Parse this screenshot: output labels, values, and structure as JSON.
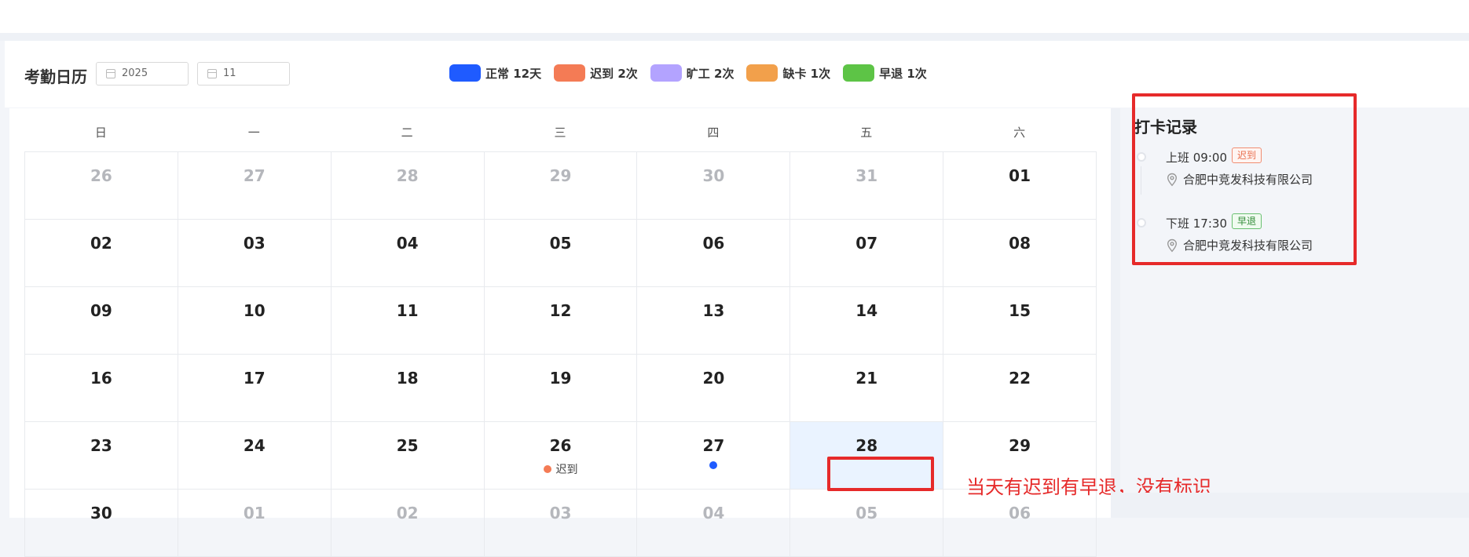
{
  "header": {
    "title": "考勤日历",
    "year_value": "2025",
    "month_value": "11"
  },
  "legend": [
    {
      "label": "正常 12天",
      "color": "#1f5bff"
    },
    {
      "label": "迟到 2次",
      "color": "#f47b55"
    },
    {
      "label": "旷工 2次",
      "color": "#b3a3ff"
    },
    {
      "label": "缺卡 1次",
      "color": "#f2a04b"
    },
    {
      "label": "早退 1次",
      "color": "#5dc446"
    }
  ],
  "calendar": {
    "weekdays": [
      "日",
      "一",
      "二",
      "三",
      "四",
      "五",
      "六"
    ],
    "days": [
      {
        "num": "26",
        "other": true
      },
      {
        "num": "27",
        "other": true
      },
      {
        "num": "28",
        "other": true
      },
      {
        "num": "29",
        "other": true
      },
      {
        "num": "30",
        "other": true
      },
      {
        "num": "31",
        "other": true
      },
      {
        "num": "01"
      },
      {
        "num": "02"
      },
      {
        "num": "03"
      },
      {
        "num": "04"
      },
      {
        "num": "05"
      },
      {
        "num": "06"
      },
      {
        "num": "07"
      },
      {
        "num": "08"
      },
      {
        "num": "09"
      },
      {
        "num": "10"
      },
      {
        "num": "11"
      },
      {
        "num": "12"
      },
      {
        "num": "13"
      },
      {
        "num": "14"
      },
      {
        "num": "15"
      },
      {
        "num": "16"
      },
      {
        "num": "17"
      },
      {
        "num": "18"
      },
      {
        "num": "19"
      },
      {
        "num": "20"
      },
      {
        "num": "21"
      },
      {
        "num": "22"
      },
      {
        "num": "23"
      },
      {
        "num": "24"
      },
      {
        "num": "25"
      },
      {
        "num": "26",
        "mark": {
          "color": "#f47b55",
          "label": "迟到"
        }
      },
      {
        "num": "27",
        "mark": {
          "color": "#1f5bff",
          "label": ""
        }
      },
      {
        "num": "28",
        "selected": true
      },
      {
        "num": "29"
      },
      {
        "num": "30"
      },
      {
        "num": "01",
        "other": true
      },
      {
        "num": "02",
        "other": true
      },
      {
        "num": "03",
        "other": true
      },
      {
        "num": "04",
        "other": true
      },
      {
        "num": "05",
        "other": true
      },
      {
        "num": "06",
        "other": true
      }
    ]
  },
  "records": {
    "title": "打卡记录",
    "items": [
      {
        "label": "上班 09:00",
        "tag": "迟到",
        "tag_type": "late",
        "location": "合肥中竞发科技有限公司"
      },
      {
        "label": "下班 17:30",
        "tag": "早退",
        "tag_type": "early",
        "location": "合肥中竞发科技有限公司"
      }
    ]
  },
  "annotation": {
    "text": "当天有迟到有早退，没有标识",
    "color": "#e62a2a"
  }
}
